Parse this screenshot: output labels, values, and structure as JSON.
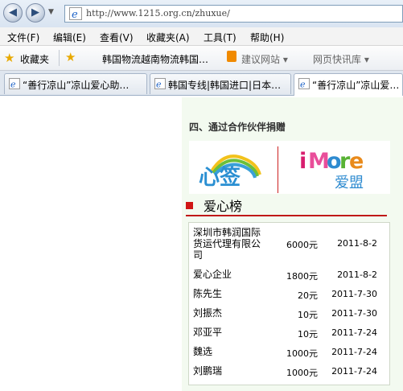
{
  "address": {
    "url": "http://www.1215.org.cn/zhuxue/"
  },
  "menu": {
    "items": [
      "文件(F)",
      "编辑(E)",
      "查看(V)",
      "收藏夹(A)",
      "工具(T)",
      "帮助(H)"
    ]
  },
  "favorites": {
    "label": "收藏夹",
    "item1": "韩国物流越南物流韩国…",
    "suggested": "建议网站 ▾",
    "webslice": "网页快讯库 ▾"
  },
  "tabs": [
    {
      "label": "“善行凉山”凉山爱心助…"
    },
    {
      "label": "韩国专线|韩国进口|日本…"
    },
    {
      "label": "“善行凉山”凉山爱…"
    }
  ],
  "page": {
    "section_title": "四、通过合作伙伴捐赠",
    "imore_sub": "爱盟",
    "rank_title": "爱心榜",
    "rows": [
      {
        "name": "深圳市韩润国际货运代理有限公司",
        "amount": "6000元",
        "date": "2011-8-2"
      },
      {
        "name": "爱心企业",
        "amount": "1800元",
        "date": "2011-8-2"
      },
      {
        "name": "陈先生",
        "amount": "20元",
        "date": "2011-7-30"
      },
      {
        "name": "刘振杰",
        "amount": "10元",
        "date": "2011-7-30"
      },
      {
        "name": "邓亚平",
        "amount": "10元",
        "date": "2011-7-24"
      },
      {
        "name": "魏选",
        "amount": "1000元",
        "date": "2011-7-24"
      },
      {
        "name": "刘鹏瑞",
        "amount": "1000元",
        "date": "2011-7-24"
      }
    ]
  }
}
